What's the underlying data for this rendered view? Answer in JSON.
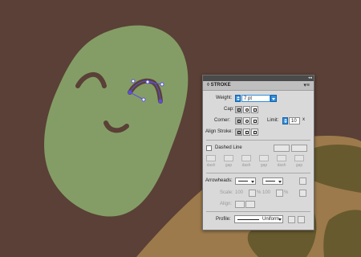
{
  "colors": {
    "background": "#5a4036",
    "blob": "#849d66",
    "shell": "#9d7a4b",
    "shell_dark": "#675a2e",
    "face_lines": "#5a4036",
    "selection": "#5b4fe0"
  },
  "panel": {
    "title": "STROKE",
    "weight": {
      "label": "Weight:",
      "value": "7 pt"
    },
    "cap": {
      "label": "Cap:"
    },
    "corner": {
      "label": "Corner:",
      "limit_label": "Limit:",
      "limit_value": "10",
      "limit_suffix": "x"
    },
    "align_stroke": {
      "label": "Align Stroke:"
    },
    "dashed_line": {
      "label": "Dashed Line",
      "checked": false
    },
    "dash_labels": [
      "dash",
      "gap",
      "dash",
      "gap",
      "dash",
      "gap"
    ],
    "arrowheads": {
      "label": "Arrowheads:"
    },
    "scale": {
      "label": "Scale:",
      "value1": "100",
      "value2": "100",
      "unit": "%"
    },
    "align": {
      "label": "Align:"
    },
    "profile": {
      "label": "Profile:",
      "value": "Uniform"
    }
  }
}
